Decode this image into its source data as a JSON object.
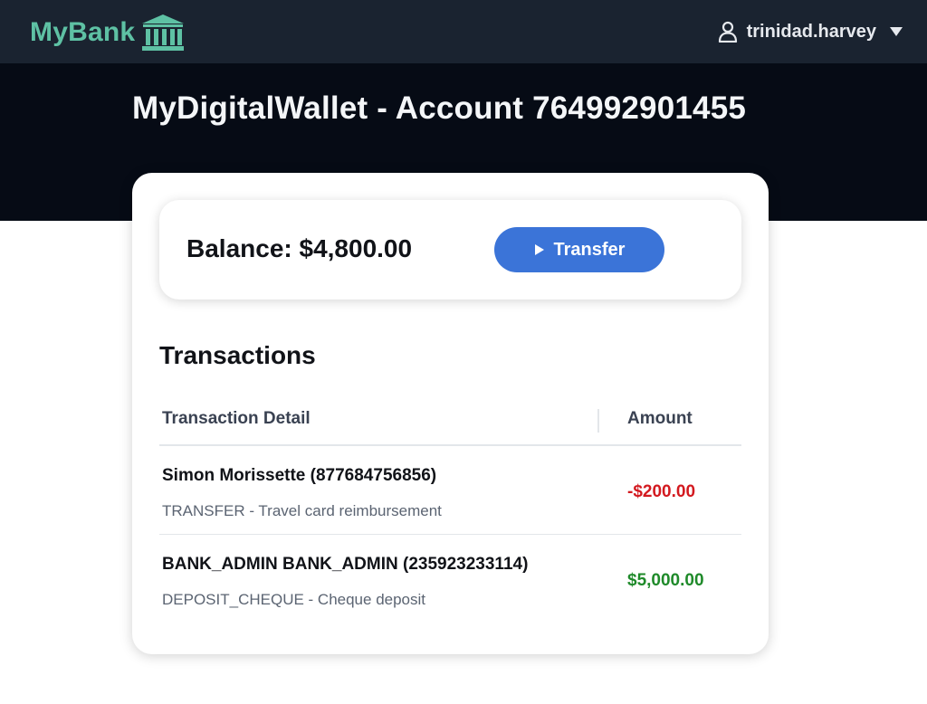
{
  "brand": {
    "name": "MyBank",
    "color": "#5ec1a4",
    "icon": "bank-building-icon"
  },
  "user": {
    "username": "trinidad.harvey",
    "icon": "user-icon",
    "menu_icon": "caret-down-icon"
  },
  "page": {
    "title": "MyDigitalWallet - Account 764992901455"
  },
  "balance": {
    "label": "Balance: $4,800.00"
  },
  "transfer": {
    "label": "Transfer",
    "icon": "play-icon",
    "color": "#3b74d8"
  },
  "transactions": {
    "heading": "Transactions",
    "columns": {
      "detail": "Transaction Detail",
      "amount": "Amount"
    },
    "rows": [
      {
        "party": "Simon Morissette (877684756856)",
        "description": "TRANSFER - Travel card reimbursement",
        "amount": "-$200.00",
        "amount_color": "#d3191f"
      },
      {
        "party": "BANK_ADMIN BANK_ADMIN (235923233114)",
        "description": "DEPOSIT_CHEQUE - Cheque deposit",
        "amount": "$5,000.00",
        "amount_color": "#1f8a2a"
      }
    ]
  }
}
